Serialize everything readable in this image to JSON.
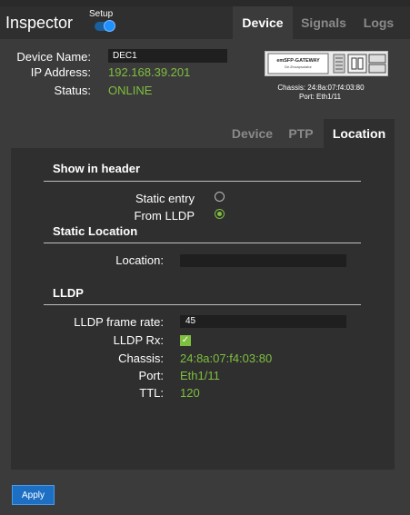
{
  "header": {
    "title": "Inspector",
    "setup_label": "Setup",
    "setup_toggle_on": true,
    "tabs": [
      {
        "label": "Device",
        "active": true
      },
      {
        "label": "Signals",
        "active": false
      },
      {
        "label": "Logs",
        "active": false
      }
    ]
  },
  "device_info": {
    "name_label": "Device Name:",
    "name_value": "DEC1",
    "ip_label": "IP Address:",
    "ip_value": "192.168.39.201",
    "status_label": "Status:",
    "status_value": "ONLINE",
    "image_title": "emSFP-GATEWAY",
    "image_subtitle": "De-Encapsulator",
    "chassis_caption": "Chassis: 24:8a:07:f4:03:80",
    "port_caption": "Port: Eth1/11"
  },
  "subtabs": [
    {
      "label": "Device",
      "active": false
    },
    {
      "label": "PTP",
      "active": false
    },
    {
      "label": "Location",
      "active": true
    }
  ],
  "show_in_header": {
    "title": "Show in header",
    "options": [
      {
        "label": "Static entry",
        "selected": false
      },
      {
        "label": "From LLDP",
        "selected": true
      }
    ]
  },
  "static_location": {
    "title": "Static Location",
    "location_label": "Location:",
    "location_value": ""
  },
  "lldp": {
    "title": "LLDP",
    "frame_rate_label": "LLDP frame rate:",
    "frame_rate_value": "45",
    "rx_label": "LLDP Rx:",
    "rx_checked": true,
    "chassis_label": "Chassis:",
    "chassis_value": "24:8a:07:f4:03:80",
    "port_label": "Port:",
    "port_value": "Eth1/11",
    "ttl_label": "TTL:",
    "ttl_value": "120"
  },
  "apply_label": "Apply",
  "colors": {
    "accent_green": "#7fbf3f",
    "accent_blue": "#1d6fc4",
    "background": "#3b3b3b",
    "panel": "#2f2f2f"
  }
}
